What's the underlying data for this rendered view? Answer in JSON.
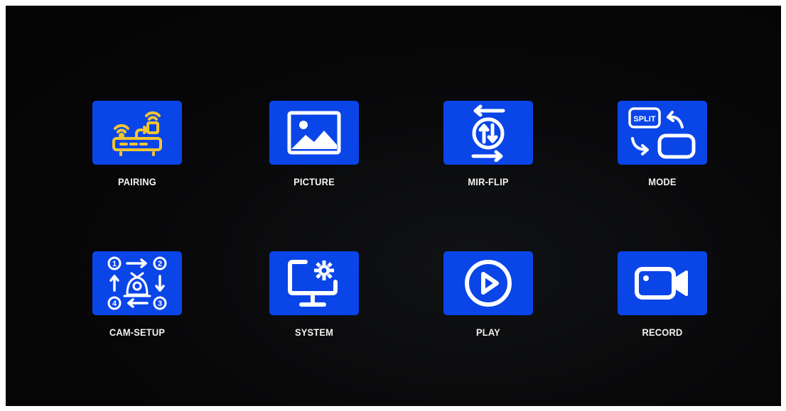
{
  "menu": {
    "items": [
      {
        "id": "pairing",
        "label": "PAIRING",
        "icon": "pairing-router-icon"
      },
      {
        "id": "picture",
        "label": "PICTURE",
        "icon": "picture-icon"
      },
      {
        "id": "mir_flip",
        "label": "MIR-FLIP",
        "icon": "mirror-flip-icon"
      },
      {
        "id": "mode",
        "label": "MODE",
        "icon": "split-mode-icon"
      },
      {
        "id": "cam_setup",
        "label": "CAM-SETUP",
        "icon": "camera-setup-icon"
      },
      {
        "id": "system",
        "label": "SYSTEM",
        "icon": "system-settings-icon"
      },
      {
        "id": "play",
        "label": "PLAY",
        "icon": "play-icon"
      },
      {
        "id": "record",
        "label": "RECORD",
        "icon": "record-camera-icon"
      }
    ],
    "icon_texts": {
      "split": "SPLIT",
      "cam_numbers": [
        "1",
        "2",
        "3",
        "4"
      ]
    }
  },
  "colors": {
    "tile": "#0a45e8",
    "icon": "#ffffff",
    "pairing_icon": "#f2c531",
    "label": "#f2f2f2",
    "background": "#050505"
  }
}
